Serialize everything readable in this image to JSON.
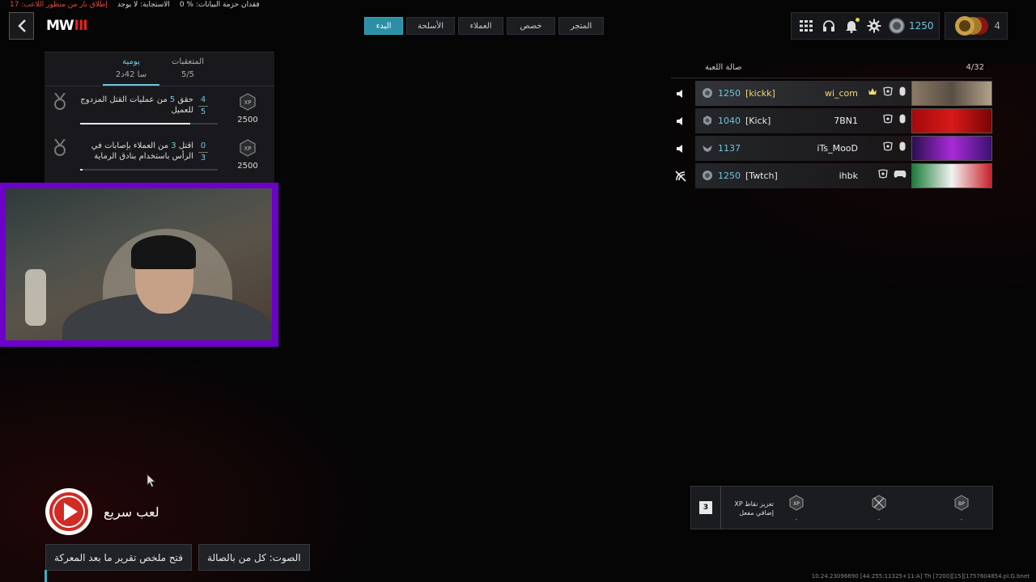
{
  "status_bar": {
    "data_loss": "فقدان حزمة البيانات: % 0",
    "response": "الاستجابة: لا يوجد",
    "fire_warning": "إطلاق نار من منظور اللاعب: 17"
  },
  "nav": {
    "tabs": [
      {
        "label": "البدء",
        "active": true
      },
      {
        "label": "الأسلحة",
        "active": false
      },
      {
        "label": "العملاء",
        "active": false
      },
      {
        "label": "خصص",
        "active": false
      },
      {
        "label": "المتجر",
        "active": false
      }
    ]
  },
  "logo": {
    "text": "MW",
    "suffix": "III"
  },
  "toolbar": {
    "cod_points": "1250",
    "notification_dot_color": "#e8d43a"
  },
  "profile": {
    "level": "4"
  },
  "challenges": {
    "tab_daily": {
      "title": "يومية",
      "sub": "2سا 42د"
    },
    "tab_trackers": {
      "title": "المتعقبات",
      "sub": "5/5"
    },
    "rows": [
      {
        "desc_prefix": "حقق ",
        "desc_hl": "5",
        "desc_rest": " من عمليات القتل المزدوج للعميل",
        "progress_current": "4",
        "progress_total": "5",
        "fill_fraction": 0.8,
        "xp": "2500"
      },
      {
        "desc_prefix": "اقتل ",
        "desc_hl": "3",
        "desc_rest": " من العملاء بإصابات في الرأس باستخدام بنادق الرماية",
        "progress_current": "0",
        "progress_total": "3",
        "fill_fraction": 0.02,
        "xp": "2500"
      }
    ]
  },
  "lobby": {
    "title": "صالة اللعبة",
    "count": "4/32",
    "players": [
      {
        "cp": "1250",
        "clan": "[kickk]",
        "name": "wi_com",
        "lead": true,
        "card_colors": [
          "#8a7a66",
          "#5a4e44",
          "#b1a28a"
        ]
      },
      {
        "cp": "1040",
        "clan": "[Kick]",
        "name": "7BN1",
        "lead": false,
        "card_colors": [
          "#a30a0a",
          "#d71a1a",
          "#7a0505"
        ]
      },
      {
        "cp": "1137",
        "clan": "",
        "name": "iTs_MooD",
        "lead": false,
        "card_colors": [
          "#2a0f50",
          "#a82bd8",
          "#3b1272"
        ]
      },
      {
        "cp": "1250",
        "clan": "[Twtch]",
        "name": "ihbk",
        "lead": false,
        "card_colors": [
          "#1b7d3a",
          "#f2f2f2",
          "#c8212b"
        ]
      }
    ]
  },
  "xp_boost": {
    "count": "3",
    "label": "تعزيز نقاط XP إضافي مفعل",
    "tokens": [
      "-",
      "-",
      "-"
    ]
  },
  "quick_play": {
    "label": "لعب سريع"
  },
  "bottom_buttons": {
    "voice": "الصوت: كل من بالصالة",
    "report": "فتح ملخص تقرير ما بعد المعركة"
  },
  "build_info": "10.24.23096690 [44:255:11325+11:A] Th [7200][15][1757604854.pl.G.bnet"
}
